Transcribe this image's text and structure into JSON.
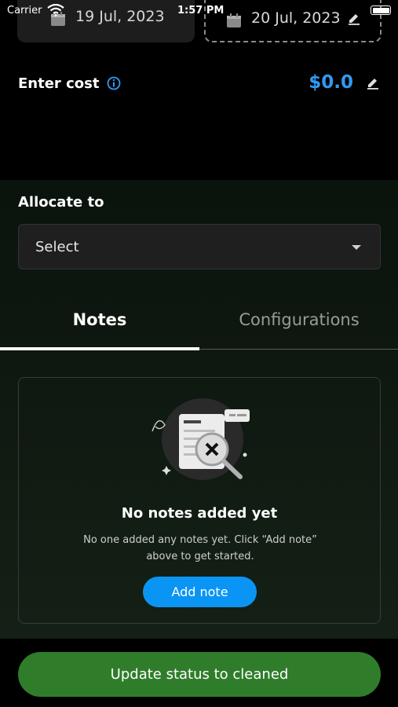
{
  "status_bar": {
    "carrier": "Carrier",
    "time": "1:57 PM"
  },
  "dates": {
    "start": "19 Jul, 2023",
    "end": "20 Jul, 2023"
  },
  "cost": {
    "label": "Enter cost",
    "value": "$0.0"
  },
  "allocate": {
    "label": "Allocate to",
    "selected": "Select"
  },
  "tabs": [
    {
      "label": "Notes",
      "active": true
    },
    {
      "label": "Configurations",
      "active": false
    }
  ],
  "notes_empty": {
    "title": "No notes added yet",
    "description": "No one added any notes yet. Click “Add note” above to get started.",
    "button": "Add note"
  },
  "footer": {
    "button": "Update status to cleaned"
  },
  "colors": {
    "accent_blue": "#2e9bf5",
    "button_blue": "#0a95f5",
    "update_green": "#2f7d2b"
  },
  "icons": [
    "wifi-icon",
    "battery-icon",
    "calendar-icon",
    "pencil-icon",
    "info-icon",
    "caret-down-icon",
    "empty-notes-illustration"
  ]
}
